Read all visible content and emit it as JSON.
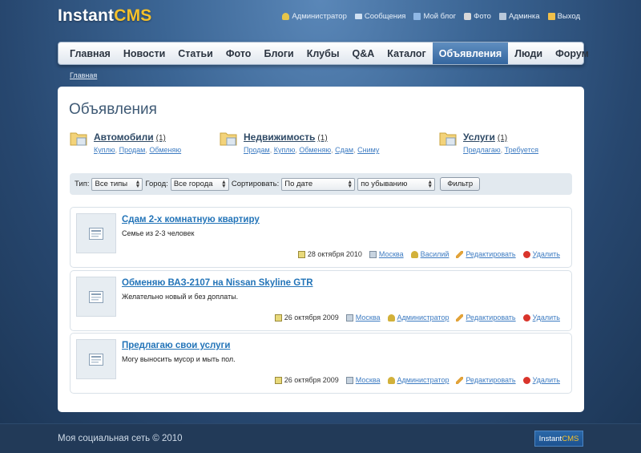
{
  "logo": {
    "instant": "Instant",
    "cms": "CMS"
  },
  "topnav": [
    {
      "label": "Администратор",
      "icon": "user-icon",
      "color": "#e6c64a"
    },
    {
      "label": "Сообщения",
      "icon": "envelope-icon",
      "color": "#cfe0f2"
    },
    {
      "label": "Мой блог",
      "icon": "blog-icon",
      "color": "#8fb8e6"
    },
    {
      "label": "Фото",
      "icon": "camera-icon",
      "color": "#d8d8d8"
    },
    {
      "label": "Админка",
      "icon": "admin-icon",
      "color": "#b8c8da"
    },
    {
      "label": "Выход",
      "icon": "logout-icon",
      "color": "#f0c04a"
    }
  ],
  "menu": [
    {
      "label": "Главная"
    },
    {
      "label": "Новости"
    },
    {
      "label": "Статьи"
    },
    {
      "label": "Фото"
    },
    {
      "label": "Блоги"
    },
    {
      "label": "Клубы"
    },
    {
      "label": "Q&A"
    },
    {
      "label": "Каталог"
    },
    {
      "label": "Объявления",
      "active": true
    },
    {
      "label": "Люди"
    },
    {
      "label": "Форум"
    }
  ],
  "breadcrumb": "Главная",
  "page_title": "Объявления",
  "categories": [
    {
      "name": "Автомобили",
      "count": "(1)",
      "subs": [
        "Куплю",
        "Продам",
        "Обменяю"
      ]
    },
    {
      "name": "Недвижимость",
      "count": "(1)",
      "subs": [
        "Продам",
        "Куплю",
        "Обменяю",
        "Сдам",
        "Сниму"
      ]
    },
    {
      "name": "Услуги",
      "count": "(1)",
      "subs": [
        "Предлагаю",
        "Требуется"
      ]
    }
  ],
  "filter": {
    "type_label": "Тип:",
    "type_value": "Все типы",
    "city_label": "Город:",
    "city_value": "Все города",
    "sort_label": "Сортировать:",
    "sort_value": "По дате",
    "order_value": "по убыванию",
    "button": "Фильтр"
  },
  "ads": [
    {
      "title": "Сдам 2-х комнатную квартиру",
      "desc": "Семье из 2-3 человек",
      "date": "28 октября 2010",
      "city": "Москва",
      "author": "Василий",
      "edit": "Редактировать",
      "delete": "Удалить"
    },
    {
      "title": "Обменяю ВАЗ-2107 на Nissan Skyline GTR",
      "desc": "Желательно новый и без доплаты.",
      "date": "26 октября 2009",
      "city": "Москва",
      "author": "Администратор",
      "edit": "Редактировать",
      "delete": "Удалить"
    },
    {
      "title": "Предлагаю свои услуги",
      "desc": "Могу выносить мусор и мыть пол.",
      "date": "26 октября 2009",
      "city": "Москва",
      "author": "Администратор",
      "edit": "Редактировать",
      "delete": "Удалить"
    }
  ],
  "footer": {
    "copyright": "Моя социальная сеть © 2010",
    "badge_a": "Instant",
    "badge_b": "CMS"
  },
  "colors": {
    "accent": "#34669f",
    "link": "#3e7cc2",
    "title_link": "#2374b8",
    "logo_yellow": "#f6c12a"
  }
}
